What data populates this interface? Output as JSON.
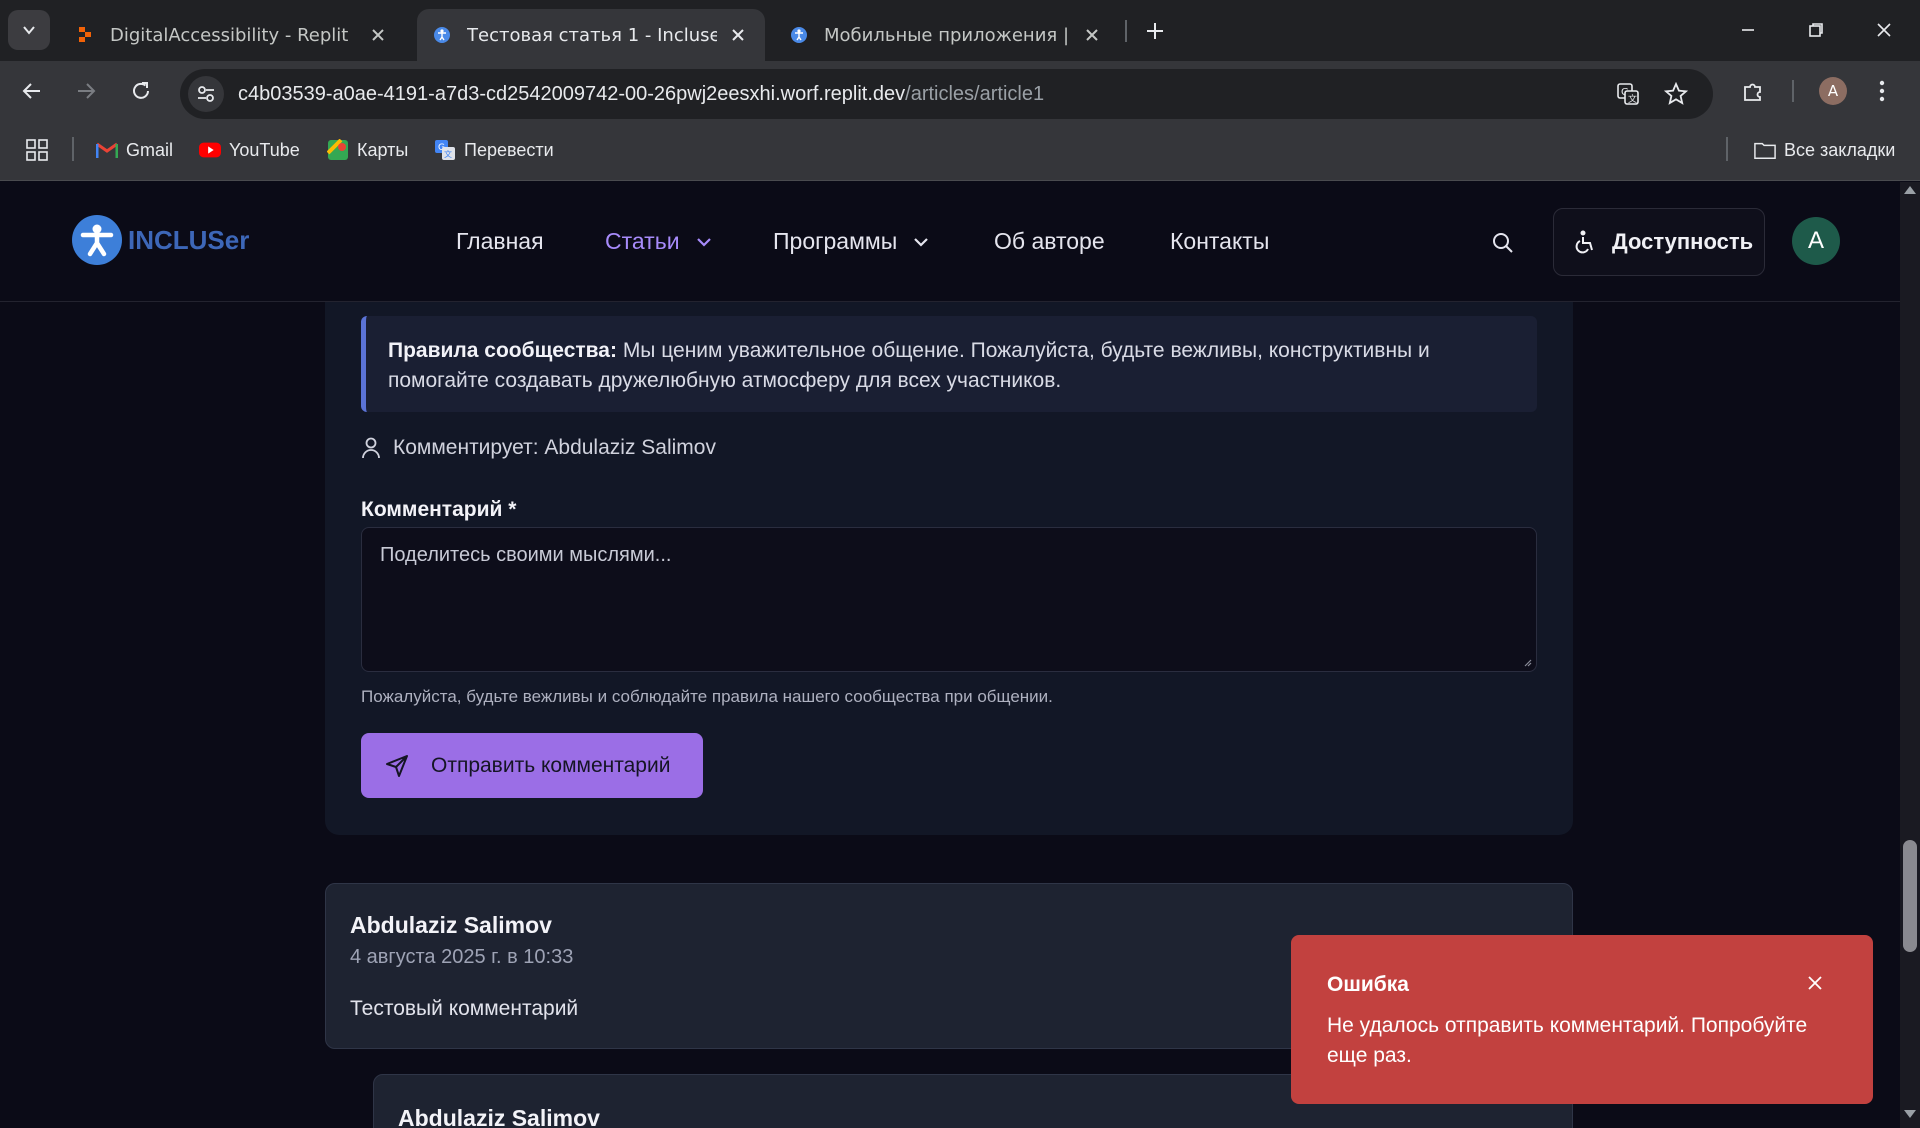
{
  "browser": {
    "tabs": [
      {
        "title": "DigitalAccessibility - Replit",
        "active": false
      },
      {
        "title": "Тестовая статья 1 - Incluser",
        "active": true
      },
      {
        "title": "Мобильные приложения | Incluser",
        "active": false
      }
    ],
    "url_host": "c4b03539-a0ae-4191-a7d3-cd2542009742-00-26pwj2eesxhi.worf.replit.dev",
    "url_path": "/articles/article1",
    "profile_initial": "A",
    "bookmarks": [
      {
        "label": "Gmail",
        "icon": "gmail-icon"
      },
      {
        "label": "YouTube",
        "icon": "youtube-icon"
      },
      {
        "label": "Карты",
        "icon": "maps-icon"
      },
      {
        "label": "Перевести",
        "icon": "translate-icon"
      }
    ],
    "all_bookmarks_label": "Все закладки"
  },
  "site": {
    "logo_text": "INCLUSer",
    "nav": [
      {
        "label": "Главная",
        "active": false
      },
      {
        "label": "Статьи",
        "active": true,
        "has_dropdown": true
      },
      {
        "label": "Программы",
        "active": false,
        "has_dropdown": true
      },
      {
        "label": "Об авторе",
        "active": false
      },
      {
        "label": "Контакты",
        "active": false
      }
    ],
    "accessibility_label": "Доступность",
    "avatar_initial": "A"
  },
  "comment_form": {
    "rules_title": "Правила сообщества:",
    "rules_text": " Мы ценим уважительное общение. Пожалуйста, будьте вежливы, конструктивны и помогайте создавать дружелюбную атмосферу для всех участников.",
    "commenter_label": "Комментирует: Abdulaziz Salimov",
    "comment_label": "Комментарий *",
    "placeholder": "Поделитесь своими мыслями...",
    "hint": "Пожалуйста, будьте вежливы и соблюдайте правила нашего сообщества при общении.",
    "submit_label": "Отправить комментарий"
  },
  "comments": [
    {
      "author": "Abdulaziz Salimov",
      "date": "4 августа 2025 г. в 10:33",
      "text": "Тестовый комментарий"
    }
  ],
  "reply": {
    "author": "Abdulaziz Salimov"
  },
  "toast": {
    "title": "Ошибка",
    "message": "Не удалось отправить комментарий. Попробуйте еще раз."
  },
  "colors": {
    "accent_purple": "#9b6ee6",
    "active_nav": "#a78bfa",
    "error_red": "#c2413f",
    "page_bg": "#0b0b17"
  }
}
